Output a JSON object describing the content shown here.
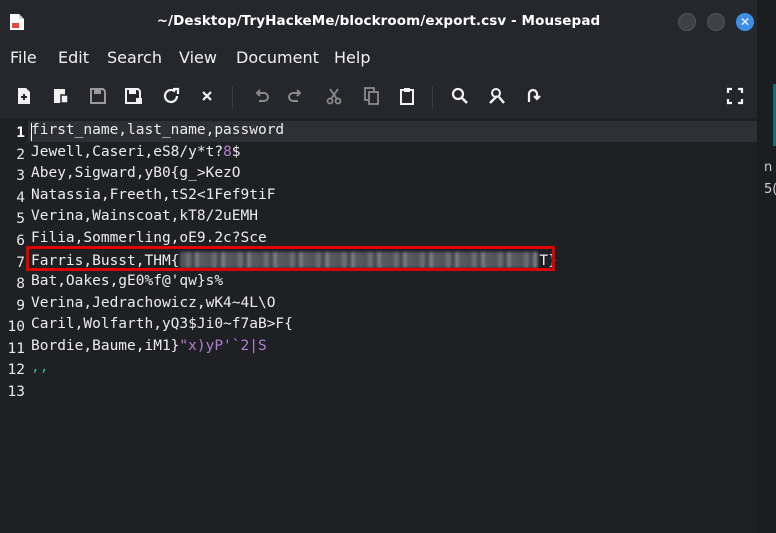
{
  "window": {
    "title": "~/Desktop/TryHackeMe/blockroom/export.csv - Mousepad"
  },
  "menu": [
    "File",
    "Edit",
    "Search",
    "View",
    "Document",
    "Help"
  ],
  "toolbar": {
    "icons": [
      "new-document-icon",
      "new-window-icon",
      "save-icon",
      "save-as-icon",
      "reload-icon",
      "close-icon",
      "undo-icon",
      "redo-icon",
      "cut-icon",
      "copy-icon",
      "paste-icon",
      "find-icon",
      "find-replace-icon",
      "go-to-line-icon",
      "fullscreen-icon"
    ]
  },
  "editor": {
    "current_line": 1,
    "lines": [
      {
        "num": "1",
        "text": "first_name,last_name,password"
      },
      {
        "num": "2",
        "text": "Jewell,Caseri,eS8/y*t?",
        "purple": "8",
        "after": "$"
      },
      {
        "num": "3",
        "text": "Abey,Sigward,yB0{g_>KezO"
      },
      {
        "num": "4",
        "text": "Natassia,Freeth,tS2<1Fef9tiF"
      },
      {
        "num": "5",
        "text": "Verina,Wainscoat,kT8/2uEMH"
      },
      {
        "num": "6",
        "text": "Filia,Sommerling,oE9.2c?Sce"
      },
      {
        "num": "7",
        "text": "Farris,Busst,THM{",
        "redacted_end": "T}"
      },
      {
        "num": "8",
        "text": "Bat,Oakes,gE0%f@'qw}s%"
      },
      {
        "num": "9",
        "text": "Verina,Jedrachowicz,wK4~4L\\O"
      },
      {
        "num": "10",
        "text": "Caril,Wolfarth,yQ3$Ji0~f7aB>F{"
      },
      {
        "num": "11",
        "text": "Bordie,Baume,iM1}",
        "purple": "\"x)yP'`2|S"
      },
      {
        "num": "12",
        "green": ",,"
      },
      {
        "num": "13",
        "text": ""
      }
    ]
  },
  "right_panel": {
    "fragments": [
      "n",
      "5("
    ]
  },
  "colors": {
    "highlight_box": "#e00000",
    "syntax_purple": "#b37fd4",
    "syntax_green": "#3bb089",
    "close_button": "#3d8ee6"
  }
}
